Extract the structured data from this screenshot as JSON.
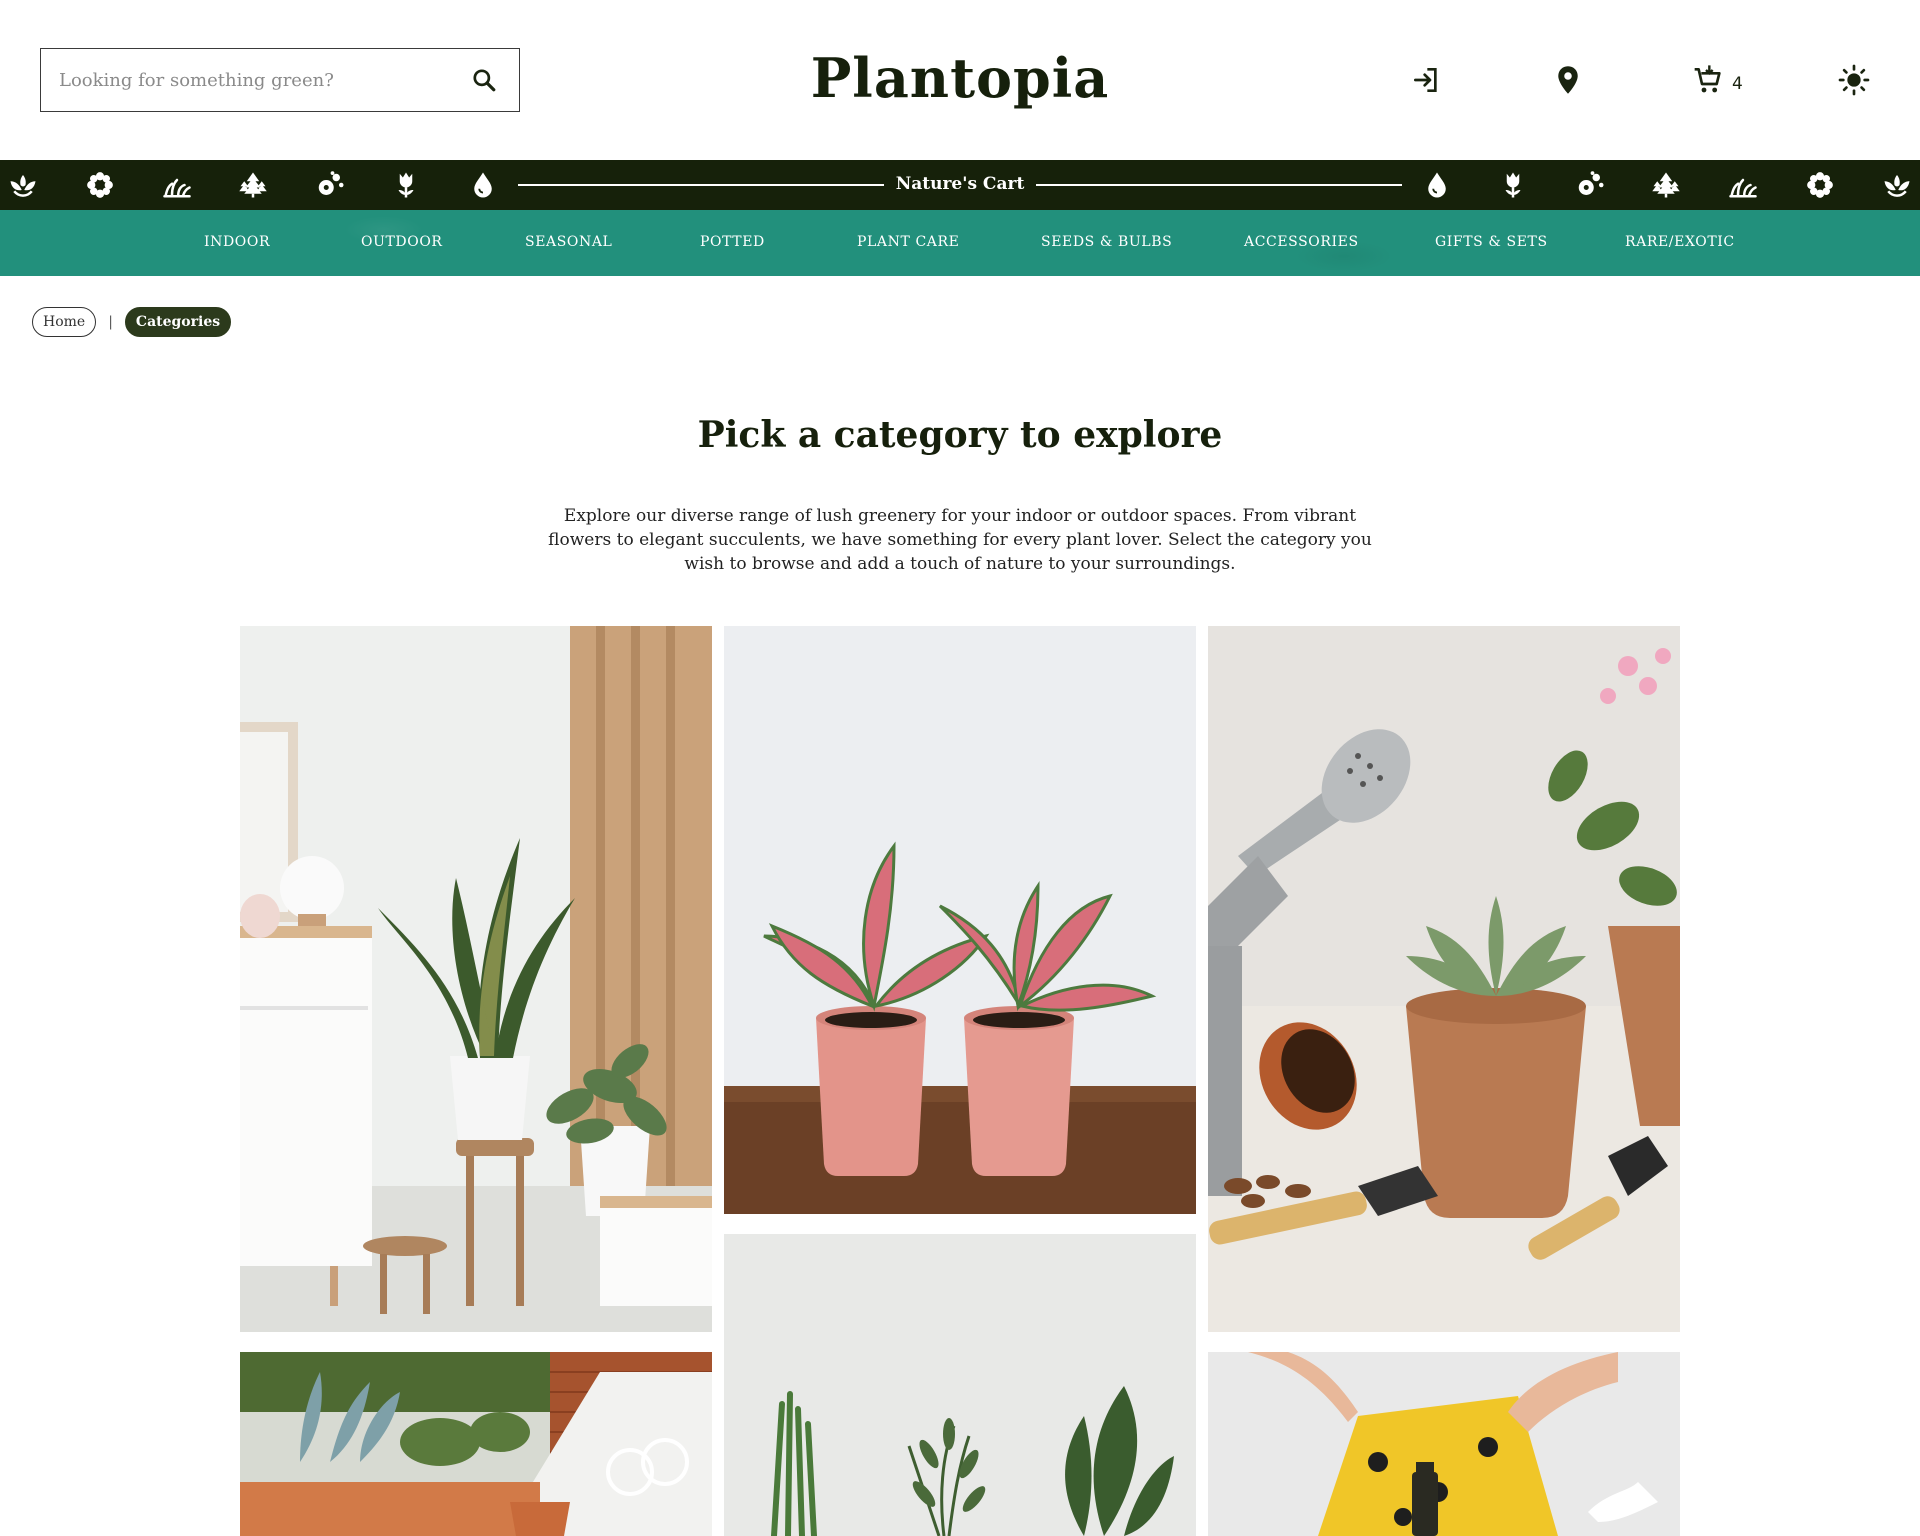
{
  "header": {
    "search_placeholder": "Looking for something green?",
    "logo": "Plantopia",
    "cart_count": "4",
    "icons": [
      "search-icon",
      "login-icon",
      "location-pin-icon",
      "cart-icon",
      "sun-icon"
    ]
  },
  "strip": {
    "title": "Nature's Cart",
    "icons": [
      "lotus-icon",
      "flower-icon",
      "grass-icon",
      "trees-icon",
      "flower-bud-icon",
      "tulip-icon",
      "water-drop-icon"
    ]
  },
  "nav": {
    "items": [
      {
        "label": "INDOOR"
      },
      {
        "label": "OUTDOOR"
      },
      {
        "label": "SEASONAL"
      },
      {
        "label": "POTTED"
      },
      {
        "label": "PLANT CARE"
      },
      {
        "label": "SEEDS & BULBS"
      },
      {
        "label": "ACCESSORIES"
      },
      {
        "label": "GIFTS & SETS"
      },
      {
        "label": "RARE/EXOTIC"
      }
    ]
  },
  "breadcrumb": {
    "home": "Home",
    "separator": "|",
    "current": "Categories"
  },
  "main": {
    "title": "Pick a category to explore",
    "intro": "Explore our diverse range of lush greenery for your indoor or outdoor spaces. From vibrant flowers to elegant succulents, we have something for every plant lover. Select the category you wish to browse and add a touch of nature to your surroundings."
  },
  "colors": {
    "dark": "#16210a",
    "teal": "#22907c",
    "breadcrumb_active": "#2c3a1c",
    "text": "#1a2410"
  }
}
